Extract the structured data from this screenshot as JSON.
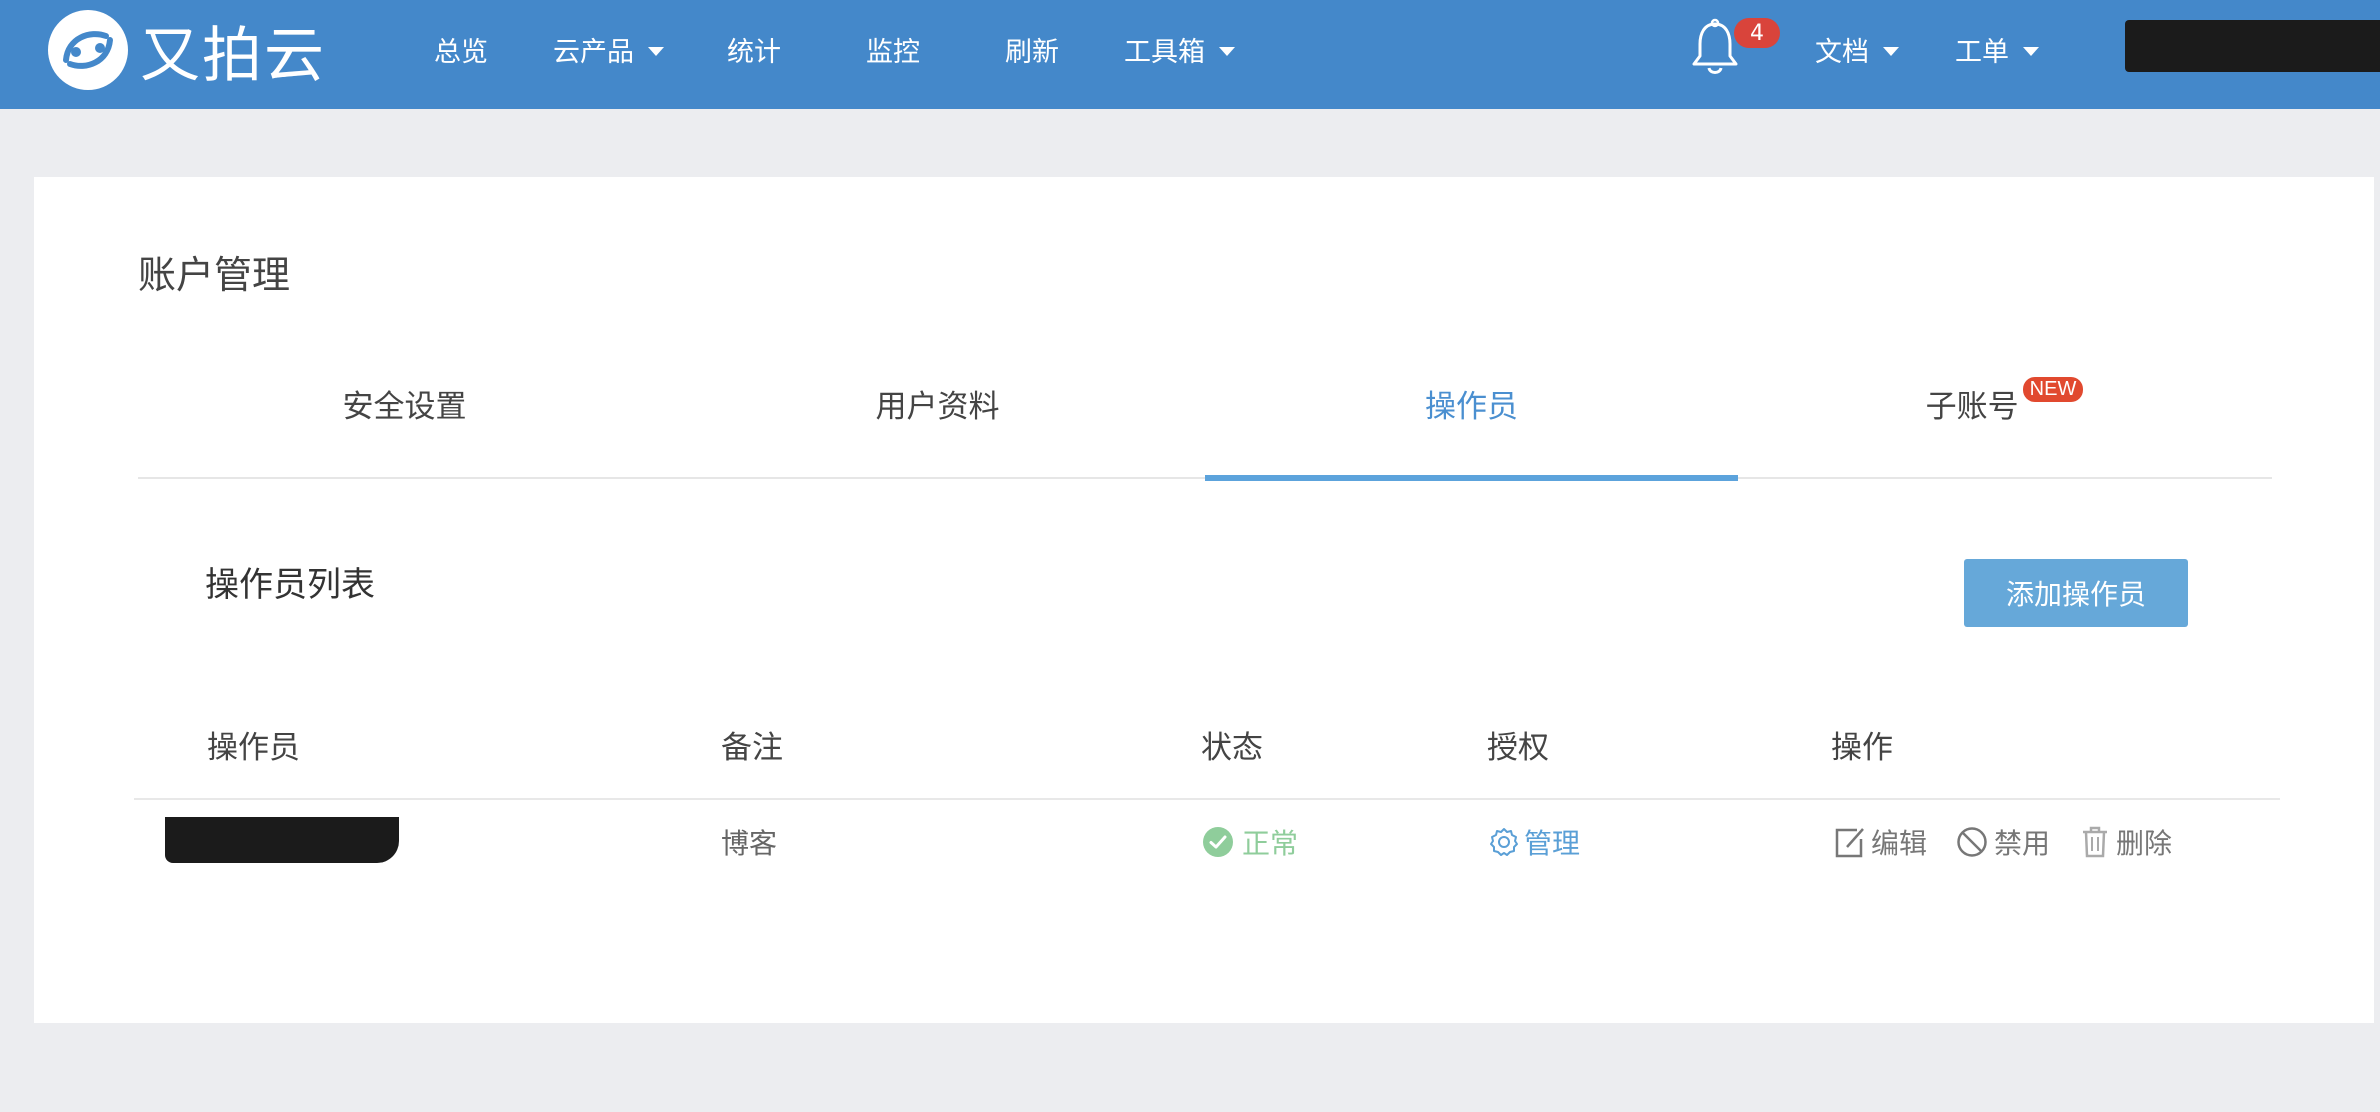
{
  "brand": {
    "name": "又拍云"
  },
  "nav": {
    "items": [
      {
        "label": "总览"
      },
      {
        "label": "云产品"
      },
      {
        "label": "统计"
      },
      {
        "label": "监控"
      },
      {
        "label": "刷新"
      },
      {
        "label": "工具箱"
      }
    ],
    "notifications_count": "4",
    "docs_label": "文档",
    "tickets_label": "工单"
  },
  "page": {
    "title": "账户管理",
    "tabs": [
      {
        "label": "安全设置"
      },
      {
        "label": "用户资料"
      },
      {
        "label": "操作员",
        "active": true
      },
      {
        "label": "子账号",
        "badge": "NEW"
      }
    ]
  },
  "operators": {
    "section_title": "操作员列表",
    "add_button": "添加操作员",
    "columns": [
      "操作员",
      "备注",
      "状态",
      "授权",
      "操作"
    ],
    "rows": [
      {
        "remark": "博客",
        "status": "正常",
        "auth": "管理",
        "actions": {
          "edit": "编辑",
          "disable": "禁用",
          "delete": "删除"
        }
      }
    ]
  },
  "colors": {
    "header_bg": "#4488ca",
    "accent": "#5ca3dc",
    "status_ok": "#8fcd9b",
    "badge_red": "#d9443b"
  }
}
